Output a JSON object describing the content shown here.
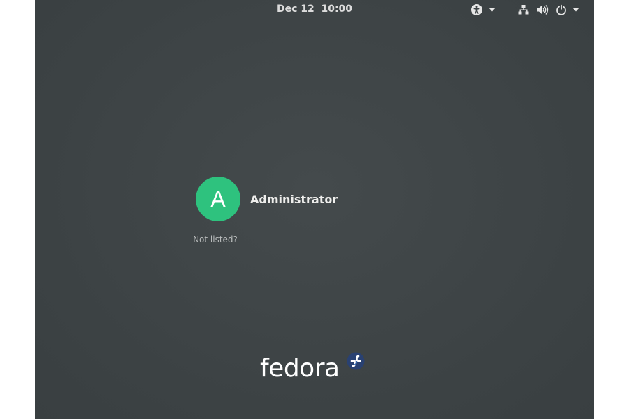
{
  "topbar": {
    "clock": "Dec 12  10:00",
    "icons": [
      "accessibility-icon",
      "network-icon",
      "volume-icon",
      "power-icon"
    ]
  },
  "users": [
    {
      "initial": "A",
      "name": "Administrator",
      "avatar_color": "#2ec27e"
    }
  ],
  "not_listed_label": "Not listed?",
  "logo": {
    "text": "fedora"
  },
  "colors": {
    "background": "#3d4345",
    "text": "#eeeeec",
    "logo_blue": "#294172",
    "logo_light_blue": "#3c6eb4"
  }
}
